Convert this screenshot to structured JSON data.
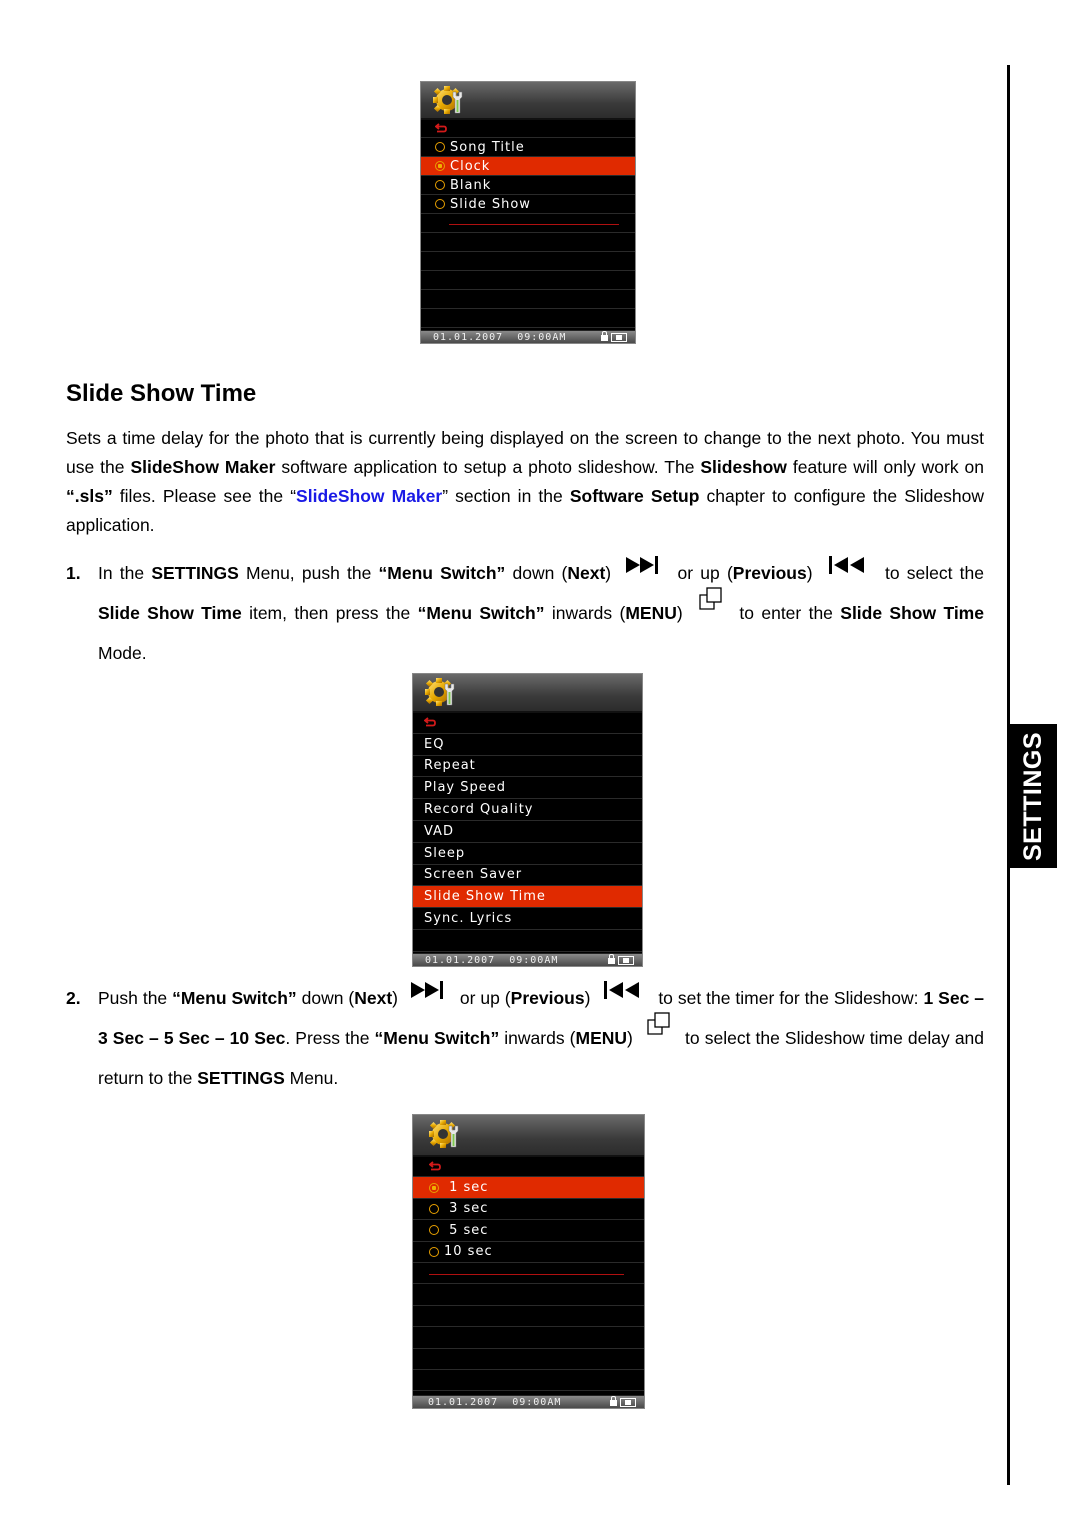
{
  "side_tab": {
    "label": "SETTINGS"
  },
  "screen1": {
    "back_icon": "back-arrow-icon",
    "items": [
      {
        "label": "Song Title",
        "selected": false
      },
      {
        "label": "Clock",
        "selected": true
      },
      {
        "label": "Blank",
        "selected": false
      },
      {
        "label": "Slide Show",
        "selected": false
      }
    ],
    "status": {
      "date": "01.01.2007",
      "time": "09:00AM"
    }
  },
  "section": {
    "title": "Slide Show Time",
    "intro": {
      "t1": "Sets a time delay for the photo that is currently being displayed on the screen to change to the next photo. You must use the ",
      "b1": "SlideShow Maker",
      "t2": " software application to setup a photo slideshow. The ",
      "b2": "Slideshow",
      "t3": " feature will only work on ",
      "b3": "“.sls”",
      "t4": " files. Please see the “",
      "link": "SlideShow Maker",
      "t5": "” section in the ",
      "b4": "Software Setup",
      "t6": " chapter to configure the Slideshow application."
    }
  },
  "step1": {
    "number": "1.",
    "t1": "In the ",
    "b1": "SETTINGS",
    "t2": " Menu, push the ",
    "b2": "“Menu Switch”",
    "t3": " down (",
    "b3": "Next",
    "t4": ")",
    "t5": " or up (",
    "b4": "Previous",
    "t6": ")",
    "t7": " to select the ",
    "b5": "Slide Show Time",
    "t8": " item, then press the ",
    "b6": "“Menu Switch”",
    "t9": " inwards (",
    "b7": "MENU",
    "t10": ")",
    "t11": " to enter the ",
    "b8": "Slide Show Time",
    "t12": " Mode."
  },
  "screen2": {
    "items": [
      {
        "label": "EQ",
        "selected": false
      },
      {
        "label": "Repeat",
        "selected": false
      },
      {
        "label": "Play Speed",
        "selected": false
      },
      {
        "label": "Record Quality",
        "selected": false
      },
      {
        "label": "VAD",
        "selected": false
      },
      {
        "label": "Sleep",
        "selected": false
      },
      {
        "label": "Screen Saver",
        "selected": false
      },
      {
        "label": "Slide Show Time",
        "selected": true
      },
      {
        "label": "Sync. Lyrics",
        "selected": false
      }
    ],
    "status": {
      "date": "01.01.2007",
      "time": "09:00AM"
    }
  },
  "step2": {
    "number": "2.",
    "t1": "Push the ",
    "b1": "“Menu Switch”",
    "t2": " down (",
    "b2": "Next",
    "t3": ")",
    "t4": " or up (",
    "b3": "Previous",
    "t5": ")",
    "t6": " to set the timer for the Slideshow: ",
    "b4": "1 Sec – 3 Sec – 5 Sec – 10 Sec",
    "t7": ". Press the ",
    "b5": "“Menu Switch”",
    "t8": " inwards (",
    "b6": "MENU",
    "t9": ")",
    "t10": " to select the Slideshow time delay and return to the ",
    "b7": "SETTINGS",
    "t11": " Menu."
  },
  "screen3": {
    "items": [
      {
        "label": " 1 sec",
        "selected": true
      },
      {
        "label": " 3 sec",
        "selected": false
      },
      {
        "label": " 5 sec",
        "selected": false
      },
      {
        "label": "10 sec",
        "selected": false
      }
    ],
    "status": {
      "date": "01.01.2007",
      "time": "09:00AM"
    }
  },
  "icons": {
    "next": "skip-next-icon",
    "previous": "skip-previous-icon",
    "menu": "menu-squares-icon",
    "settings": "settings-gear-wrench-icon"
  }
}
